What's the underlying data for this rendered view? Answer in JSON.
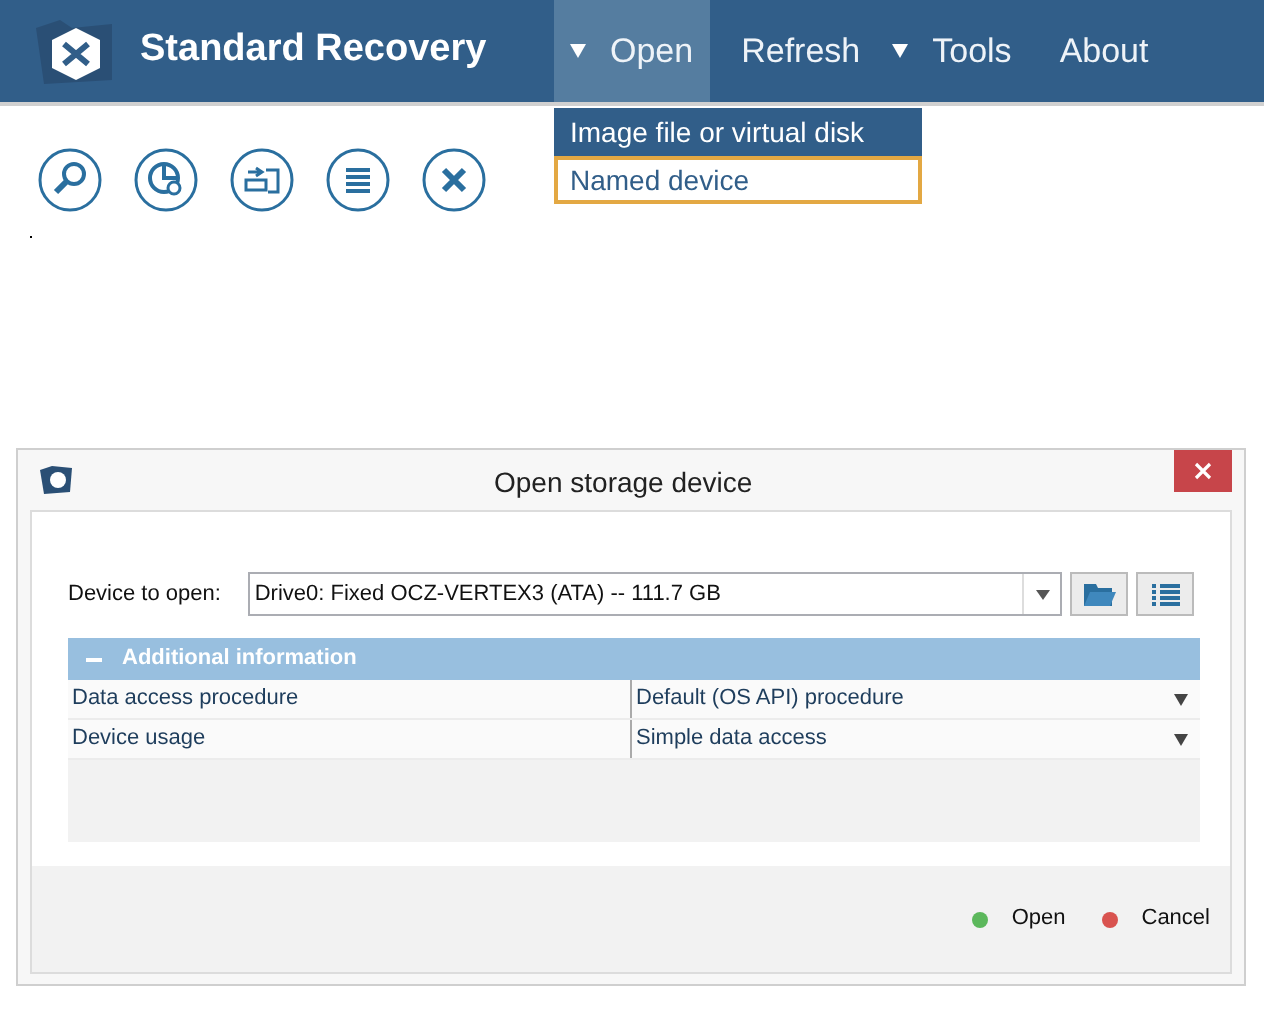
{
  "app": {
    "title": "Standard Recovery"
  },
  "menu": [
    {
      "label": "Open",
      "dropdown": true,
      "selected": true
    },
    {
      "label": "Refresh",
      "dropdown": false,
      "selected": false
    },
    {
      "label": "Tools",
      "dropdown": true,
      "selected": false
    },
    {
      "label": "About",
      "dropdown": false,
      "selected": false
    }
  ],
  "open_menu": {
    "items": [
      {
        "label": "Image file or virtual disk",
        "highlighted": true,
        "focused": false
      },
      {
        "label": "Named device",
        "highlighted": false,
        "focused": true
      }
    ]
  },
  "dialog": {
    "title": "Open storage device",
    "device_label": "Device to open:",
    "device_value": "Drive0: Fixed OCZ-VERTEX3 (ATA) -- 111.7 GB",
    "section": {
      "title": "Additional information",
      "expanded": true
    },
    "properties": [
      {
        "name": "Data access procedure",
        "value": "Default (OS API) procedure"
      },
      {
        "name": "Device usage",
        "value": "Simple data access"
      }
    ],
    "buttons": [
      {
        "label": "Open",
        "color": "#5cb85c"
      },
      {
        "label": "Cancel",
        "color": "#d9534f"
      }
    ]
  }
}
